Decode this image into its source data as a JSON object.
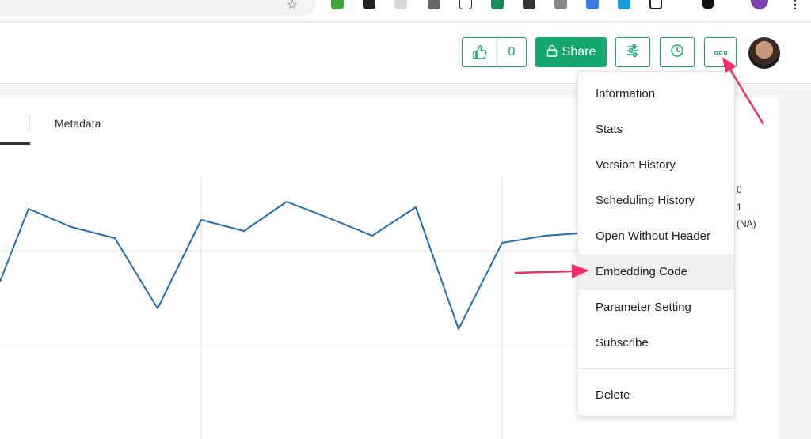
{
  "header": {
    "like_count": "0",
    "share_label": "Share"
  },
  "tabs": {
    "metadata_label": "Metadata"
  },
  "legend": {
    "values": [
      "0",
      "1",
      "(NA)"
    ]
  },
  "menu": {
    "items": [
      "Information",
      "Stats",
      "Version History",
      "Scheduling History",
      "Open Without Header",
      "Embedding Code",
      "Parameter Setting",
      "Subscribe"
    ],
    "delete_label": "Delete",
    "highlighted": "Embedding Code"
  },
  "colors": {
    "accent": "#14a86f",
    "line": "#1f6fb2",
    "annotation": "#f0306a"
  },
  "icons": {
    "like": "thumbs-up-icon",
    "share": "lock-icon",
    "settings": "sliders-icon",
    "schedule": "clock-icon",
    "more": "more-dots-icon"
  }
}
